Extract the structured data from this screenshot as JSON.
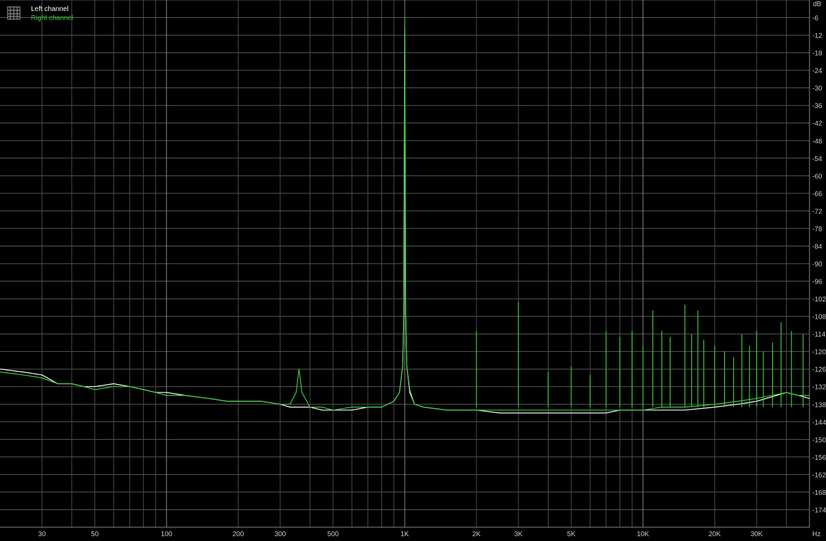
{
  "chart_data": {
    "type": "line",
    "x_scale": "log",
    "xlim": [
      20,
      50000
    ],
    "ylim": [
      -180,
      0
    ],
    "grid": true,
    "legend_position": "top-left",
    "x_unit": "Hz",
    "y_unit": "dB",
    "x_tick_labels": [
      "30",
      "50",
      "100",
      "200",
      "300",
      "500",
      "1K",
      "2K",
      "3K",
      "5K",
      "10K",
      "20K",
      "30K"
    ],
    "x_tick_values": [
      30,
      50,
      100,
      200,
      300,
      500,
      1000,
      2000,
      3000,
      5000,
      10000,
      20000,
      30000
    ],
    "y_ticks": [
      -6,
      -12,
      -18,
      -24,
      -30,
      -36,
      -42,
      -48,
      -54,
      -60,
      -66,
      -72,
      -78,
      -84,
      -90,
      -96,
      -102,
      -108,
      -114,
      -120,
      -126,
      -132,
      -138,
      -144,
      -150,
      -156,
      -162,
      -168,
      -174
    ],
    "series": [
      {
        "name": "Left channel",
        "color": "#ffffff",
        "x": [
          20,
          25,
          30,
          35,
          40,
          45,
          50,
          60,
          70,
          80,
          90,
          100,
          120,
          150,
          180,
          200,
          250,
          300,
          330,
          360,
          400,
          450,
          500,
          600,
          700,
          800,
          900,
          950,
          980,
          990,
          1000,
          1010,
          1020,
          1050,
          1100,
          1200,
          1500,
          2000,
          2500,
          3000,
          4000,
          5000,
          6000,
          7000,
          8000,
          10000,
          12000,
          15000,
          20000,
          25000,
          30000,
          40000,
          45000,
          50000
        ],
        "y": [
          -126,
          -127,
          -128,
          -131,
          -131,
          -132,
          -132,
          -131,
          -132,
          -133,
          -134,
          -134,
          -135,
          -136,
          -137,
          -137,
          -137,
          -138,
          -139,
          -139,
          -139,
          -140,
          -140,
          -140,
          -139,
          -139,
          -137,
          -134,
          -125,
          -108,
          -10,
          -108,
          -125,
          -134,
          -138,
          -139,
          -140,
          -140,
          -141,
          -141,
          -141,
          -141,
          -141,
          -141,
          -140,
          -140,
          -140,
          -140,
          -139,
          -138,
          -137,
          -134,
          -135,
          -136
        ]
      },
      {
        "name": "Right channel",
        "color": "#3ccc3c",
        "x": [
          20,
          25,
          30,
          35,
          40,
          45,
          50,
          60,
          70,
          80,
          90,
          100,
          120,
          150,
          180,
          200,
          250,
          300,
          330,
          350,
          360,
          370,
          400,
          450,
          500,
          600,
          700,
          800,
          900,
          950,
          980,
          990,
          1000,
          1010,
          1020,
          1050,
          1100,
          1200,
          1500,
          2000,
          2500,
          3000,
          4000,
          5000,
          6000,
          7000,
          8000,
          10000,
          12000,
          15000,
          20000,
          25000,
          30000,
          40000,
          45000,
          50000
        ],
        "y": [
          -127,
          -128,
          -129,
          -131,
          -131,
          -132,
          -133,
          -132,
          -132,
          -133,
          -134,
          -135,
          -135,
          -136,
          -137,
          -137,
          -137,
          -138,
          -138,
          -134,
          -126,
          -134,
          -139,
          -139,
          -140,
          -139,
          -139,
          -139,
          -137,
          -134,
          -125,
          -108,
          -6,
          -108,
          -125,
          -133,
          -138,
          -139,
          -140,
          -140,
          -140,
          -140,
          -140,
          -140,
          -140,
          -140,
          -140,
          -140,
          -139,
          -139,
          -138,
          -137,
          -136,
          -134,
          -135,
          -135
        ]
      }
    ],
    "harmonic_spikes": [
      {
        "x": 2000,
        "y": -113
      },
      {
        "x": 3000,
        "y": -103
      },
      {
        "x": 4000,
        "y": -127
      },
      {
        "x": 5000,
        "y": -125
      },
      {
        "x": 6000,
        "y": -128
      },
      {
        "x": 7000,
        "y": -113
      },
      {
        "x": 8000,
        "y": -115
      },
      {
        "x": 9000,
        "y": -113
      },
      {
        "x": 10000,
        "y": -118
      },
      {
        "x": 11000,
        "y": -106
      },
      {
        "x": 12000,
        "y": -113
      },
      {
        "x": 13000,
        "y": -115
      },
      {
        "x": 15000,
        "y": -104
      },
      {
        "x": 16000,
        "y": -114
      },
      {
        "x": 17000,
        "y": -106
      },
      {
        "x": 18000,
        "y": -116
      },
      {
        "x": 20000,
        "y": -118
      },
      {
        "x": 22000,
        "y": -120
      },
      {
        "x": 24000,
        "y": -122
      },
      {
        "x": 26000,
        "y": -114
      },
      {
        "x": 28000,
        "y": -118
      },
      {
        "x": 30000,
        "y": -113
      },
      {
        "x": 32000,
        "y": -120
      },
      {
        "x": 35000,
        "y": -117
      },
      {
        "x": 38000,
        "y": -110
      },
      {
        "x": 42000,
        "y": -113
      },
      {
        "x": 47000,
        "y": -114
      }
    ]
  }
}
